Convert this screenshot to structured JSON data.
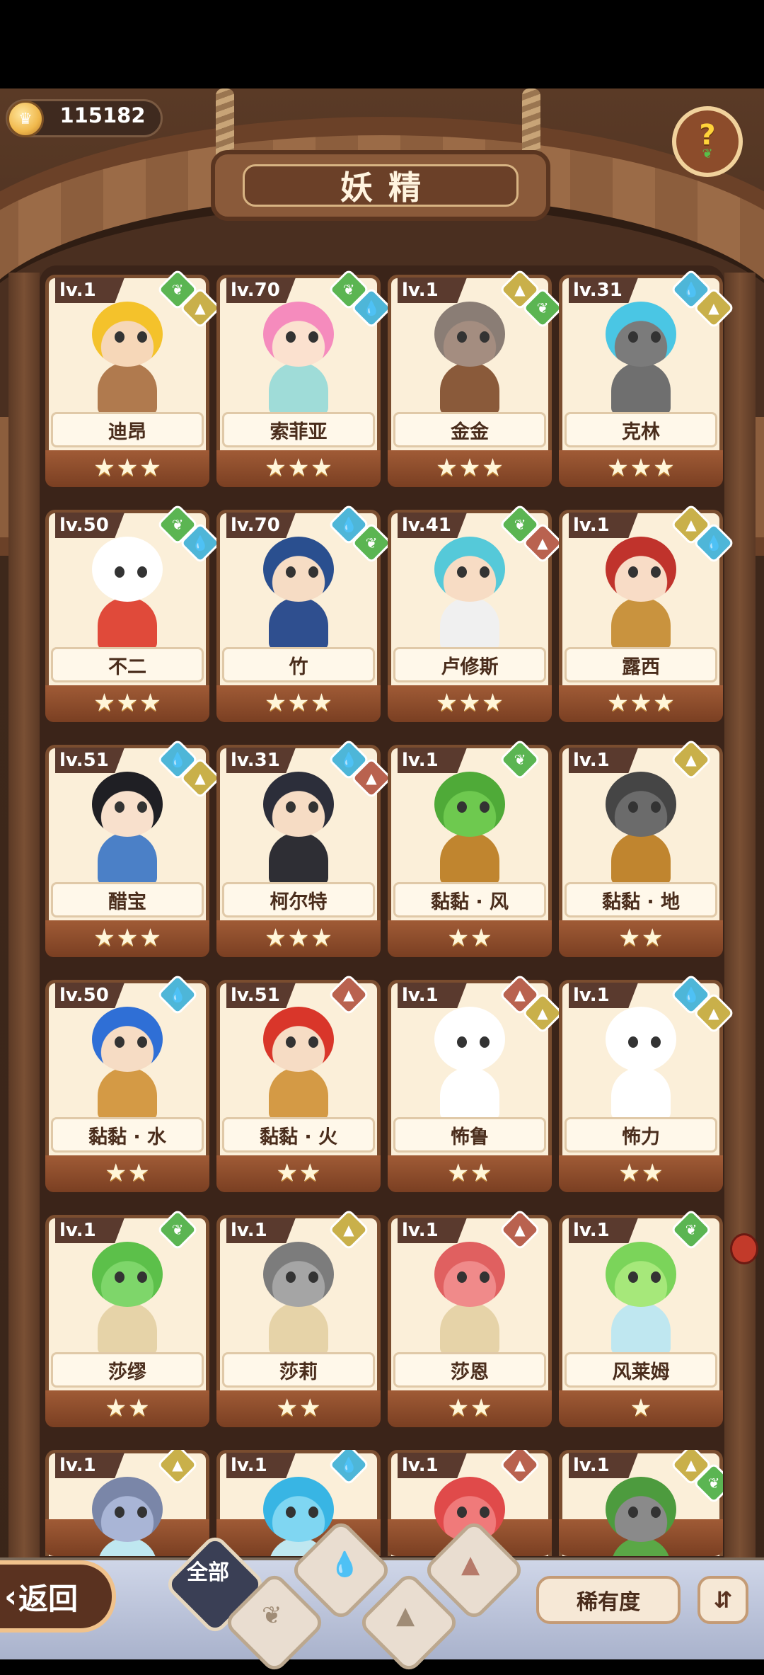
{
  "currency": {
    "value": "115182",
    "icon": "crown-coin-icon"
  },
  "help": {
    "icon": "question-sprout-icon",
    "glyph": "?"
  },
  "title": "妖精",
  "cards": [
    {
      "level": "lv.1",
      "name": "迪昂",
      "stars": 3,
      "elements": [
        "wind",
        "earth"
      ],
      "hair": "#f4c22b",
      "skin": "#f6d7b8",
      "body": "#b07a4e"
    },
    {
      "level": "lv.70",
      "name": "索菲亚",
      "stars": 3,
      "elements": [
        "wind",
        "water"
      ],
      "hair": "#f58bbd",
      "skin": "#fbe1cf",
      "body": "#9fdcd8"
    },
    {
      "level": "lv.1",
      "name": "金金",
      "stars": 3,
      "elements": [
        "earth",
        "wind"
      ],
      "hair": "#8a7d75",
      "skin": "#a48d80",
      "body": "#8a5a3a"
    },
    {
      "level": "lv.31",
      "name": "克林",
      "stars": 3,
      "elements": [
        "water",
        "earth"
      ],
      "hair": "#4ac6e4",
      "skin": "#7b7b7b",
      "body": "#6f6f6f"
    },
    {
      "level": "lv.50",
      "name": "不二",
      "stars": 3,
      "elements": [
        "wind",
        "water"
      ],
      "hair": "#ffffff",
      "skin": "#ffffff",
      "body": "#e04a3a"
    },
    {
      "level": "lv.70",
      "name": "竹",
      "stars": 3,
      "elements": [
        "water",
        "wind"
      ],
      "hair": "#2a4f8f",
      "skin": "#f6dcc4",
      "body": "#2f4f8f"
    },
    {
      "level": "lv.41",
      "name": "卢修斯",
      "stars": 3,
      "elements": [
        "wind",
        "fire"
      ],
      "hair": "#55c9d9",
      "skin": "#f7dcc4",
      "body": "#f0f0f0"
    },
    {
      "level": "lv.1",
      "name": "露西",
      "stars": 3,
      "elements": [
        "earth",
        "water"
      ],
      "hair": "#c0332c",
      "skin": "#f8dcc6",
      "body": "#c9933e"
    },
    {
      "level": "lv.51",
      "name": "醋宝",
      "stars": 3,
      "elements": [
        "water",
        "earth"
      ],
      "hair": "#1f1f24",
      "skin": "#f8e0cc",
      "body": "#4b80c7"
    },
    {
      "level": "lv.31",
      "name": "柯尔特",
      "stars": 3,
      "elements": [
        "water",
        "fire"
      ],
      "hair": "#2c2e3a",
      "skin": "#f6dcc4",
      "body": "#2e2e34"
    },
    {
      "level": "lv.1",
      "name": "黏黏 · 风",
      "stars": 2,
      "elements": [
        "wind"
      ],
      "hair": "#4faa38",
      "skin": "#6ec94f",
      "body": "#c0852f"
    },
    {
      "level": "lv.1",
      "name": "黏黏 · 地",
      "stars": 2,
      "elements": [
        "earth"
      ],
      "hair": "#454545",
      "skin": "#6b6b6b",
      "body": "#c0852f"
    },
    {
      "level": "lv.50",
      "name": "黏黏 · 水",
      "stars": 2,
      "elements": [
        "water"
      ],
      "hair": "#2f6fd6",
      "skin": "#f6dcc4",
      "body": "#d49a45"
    },
    {
      "level": "lv.51",
      "name": "黏黏 · 火",
      "stars": 2,
      "elements": [
        "fire"
      ],
      "hair": "#d9362a",
      "skin": "#f6dcc4",
      "body": "#d49a45"
    },
    {
      "level": "lv.1",
      "name": "怖鲁",
      "stars": 2,
      "elements": [
        "fire",
        "earth"
      ],
      "hair": "#ffffff",
      "skin": "#ffffff",
      "body": "#ffffff"
    },
    {
      "level": "lv.1",
      "name": "怖力",
      "stars": 2,
      "elements": [
        "water",
        "earth"
      ],
      "hair": "#ffffff",
      "skin": "#ffffff",
      "body": "#ffffff"
    },
    {
      "level": "lv.1",
      "name": "莎缪",
      "stars": 2,
      "elements": [
        "wind"
      ],
      "hair": "#5cc04a",
      "skin": "#7ed66a",
      "body": "#e6d3a8"
    },
    {
      "level": "lv.1",
      "name": "莎莉",
      "stars": 2,
      "elements": [
        "earth"
      ],
      "hair": "#7c7c7c",
      "skin": "#a5a5a5",
      "body": "#e6d3a8"
    },
    {
      "level": "lv.1",
      "name": "莎恩",
      "stars": 2,
      "elements": [
        "fire"
      ],
      "hair": "#e06060",
      "skin": "#f08a8a",
      "body": "#e6d3a8"
    },
    {
      "level": "lv.1",
      "name": "风莱姆",
      "stars": 1,
      "elements": [
        "wind"
      ],
      "hair": "#7bd45a",
      "skin": "#a6e87a",
      "body": "#bfe7f0"
    },
    {
      "level": "lv.1",
      "name": "",
      "stars": 0,
      "elements": [
        "earth"
      ],
      "hair": "#7a86a8",
      "skin": "#a9b5d6",
      "body": "#bfe7f0"
    },
    {
      "level": "lv.1",
      "name": "",
      "stars": 0,
      "elements": [
        "water"
      ],
      "hair": "#38b5e4",
      "skin": "#7fd6f2",
      "body": "#bfe7f0"
    },
    {
      "level": "lv.1",
      "name": "",
      "stars": 0,
      "elements": [
        "fire"
      ],
      "hair": "#e04a4a",
      "skin": "#f07a7a",
      "body": "#bfe7f0"
    },
    {
      "level": "lv.1",
      "name": "",
      "stars": 0,
      "elements": [
        "earth",
        "wind"
      ],
      "hair": "#4d9b3e",
      "skin": "#8a8a8a",
      "body": "#5aa846"
    }
  ],
  "bottom": {
    "back_arrow": "‹",
    "back_label": "返回",
    "tab_all": "全部",
    "sort_label": "稀有度",
    "order_icon": "⇵"
  }
}
